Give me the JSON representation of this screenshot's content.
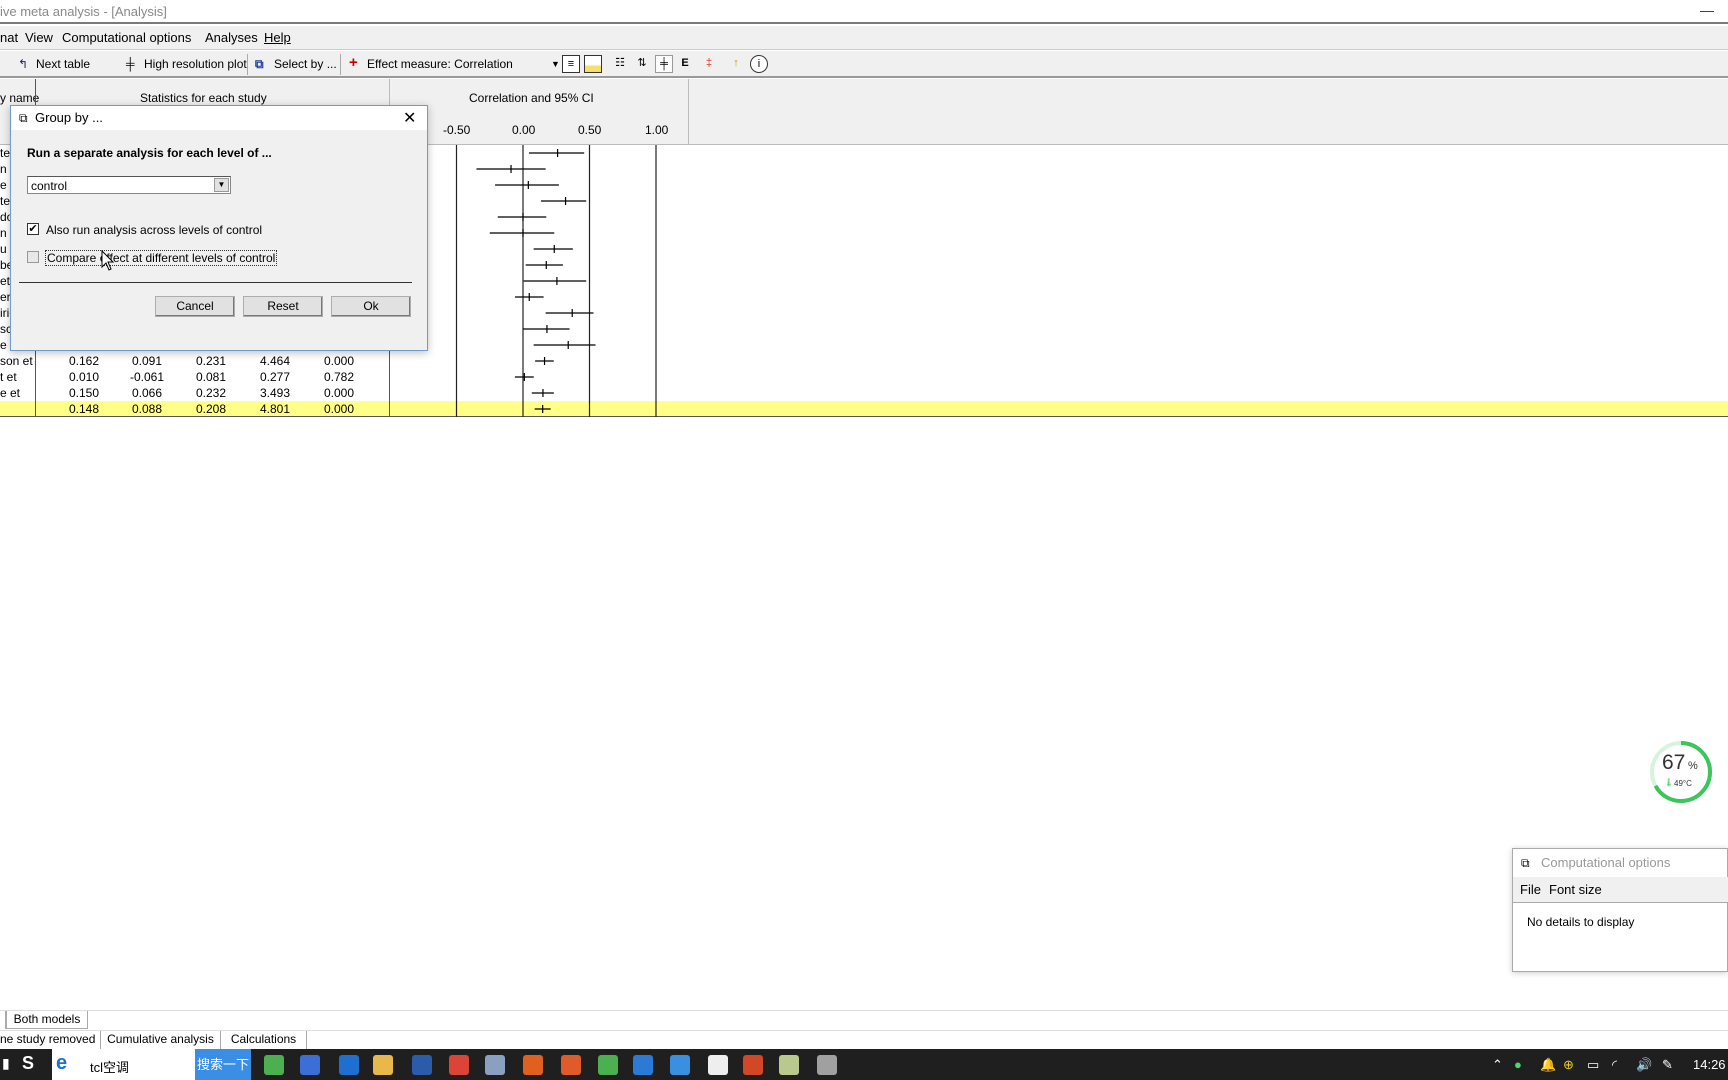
{
  "window": {
    "title": "ive meta analysis - [Analysis]",
    "minimize": "—"
  },
  "menu": [
    "nat",
    "View",
    "Computational options",
    "Analyses",
    "Help"
  ],
  "toolbar": {
    "next_table": "Next table",
    "high_res": "High resolution plot",
    "select_by": "Select by ...",
    "effect_measure": "Effect measure:  Correlation"
  },
  "table": {
    "col_study": "y name",
    "col_stats": "Statistics for each study",
    "col_plot": "Correlation and 95% CI",
    "axis_ticks": [
      "-0.50",
      "0.00",
      "0.50",
      "1.00"
    ],
    "rows": [
      {
        "name": "ter"
      },
      {
        "name": "n ("
      },
      {
        "name": "e"
      },
      {
        "name": "ter"
      },
      {
        "name": "do"
      },
      {
        "name": "n"
      },
      {
        "name": "u e"
      },
      {
        "name": "bel"
      },
      {
        "name": "et"
      },
      {
        "name": "er ("
      },
      {
        "name": "irig"
      },
      {
        "name": "sc"
      },
      {
        "name": "e e"
      },
      {
        "name": "son et",
        "values": [
          "0.162",
          "0.091",
          "0.231",
          "4.464",
          "0.000"
        ]
      },
      {
        "name": "t et",
        "values": [
          "0.010",
          "-0.061",
          "0.081",
          "0.277",
          "0.782"
        ]
      },
      {
        "name": "e et",
        "values": [
          "0.150",
          "0.066",
          "0.232",
          "3.493",
          "0.000"
        ]
      },
      {
        "name": "",
        "values": [
          "0.148",
          "0.088",
          "0.208",
          "4.801",
          "0.000"
        ],
        "summary": true
      }
    ]
  },
  "chart_data": {
    "type": "forest",
    "title": "Correlation and 95% CI",
    "xlim": [
      -0.5,
      1.0
    ],
    "xticks": [
      -0.5,
      0.0,
      0.5,
      1.0
    ],
    "points": [
      {
        "est": 0.26,
        "lo": 0.045,
        "hi": 0.46
      },
      {
        "est": -0.09,
        "lo": -0.35,
        "hi": 0.17
      },
      {
        "est": 0.04,
        "lo": -0.21,
        "hi": 0.27
      },
      {
        "est": 0.32,
        "lo": 0.135,
        "hi": 0.475
      },
      {
        "est": 0.0,
        "lo": -0.19,
        "hi": 0.175
      },
      {
        "est": 0.0,
        "lo": -0.25,
        "hi": 0.235
      },
      {
        "est": 0.235,
        "lo": 0.08,
        "hi": 0.375
      },
      {
        "est": 0.175,
        "lo": 0.02,
        "hi": 0.3
      },
      {
        "est": 0.255,
        "lo": 0.005,
        "hi": 0.475
      },
      {
        "est": 0.047,
        "lo": -0.06,
        "hi": 0.155
      },
      {
        "est": 0.37,
        "lo": 0.17,
        "hi": 0.53
      },
      {
        "est": 0.18,
        "lo": 0.0,
        "hi": 0.35
      },
      {
        "est": 0.34,
        "lo": 0.08,
        "hi": 0.545
      },
      {
        "est": 0.162,
        "lo": 0.091,
        "hi": 0.231
      },
      {
        "est": 0.01,
        "lo": -0.061,
        "hi": 0.081
      },
      {
        "est": 0.15,
        "lo": 0.066,
        "hi": 0.232
      },
      {
        "est": 0.148,
        "lo": 0.088,
        "hi": 0.208
      }
    ]
  },
  "dialog": {
    "title": "Group by ...",
    "heading": "Run a separate analysis for each level of ...",
    "select_value": "control",
    "check1": {
      "label": "Also run analysis across levels of control",
      "checked": true
    },
    "check2": {
      "label": "Compare effect at different levels of control",
      "checked": false
    },
    "cancel": "Cancel",
    "reset": "Reset",
    "ok": "Ok"
  },
  "bottom_tabs": {
    "row1": [
      "Both models"
    ],
    "row2": [
      "ne study removed",
      "Cumulative analysis",
      "Calculations"
    ]
  },
  "gauge": {
    "percent": "67",
    "unit": "%",
    "temp": "49°C",
    "level": 0.67,
    "color": "#3cc55a"
  },
  "comp_options": {
    "title": "Computational options",
    "menu": [
      "File",
      "Font size"
    ],
    "body": "No details to display"
  },
  "taskbar": {
    "search_text": "tcl空调",
    "search_button": "搜索一下",
    "clock": "14:26",
    "apps": [
      "#4caf50",
      "#3b6fd6",
      "#1e6fd0",
      "#e8b84a",
      "#2a5caa",
      "#db4437",
      "#8aa0c0",
      "#e06020",
      "#e05a2a",
      "#4caf50",
      "#2b7bd6",
      "#3a8fe0",
      "#eeeeee",
      "#d24726",
      "#b9c98b",
      "#a0a0a0"
    ]
  }
}
